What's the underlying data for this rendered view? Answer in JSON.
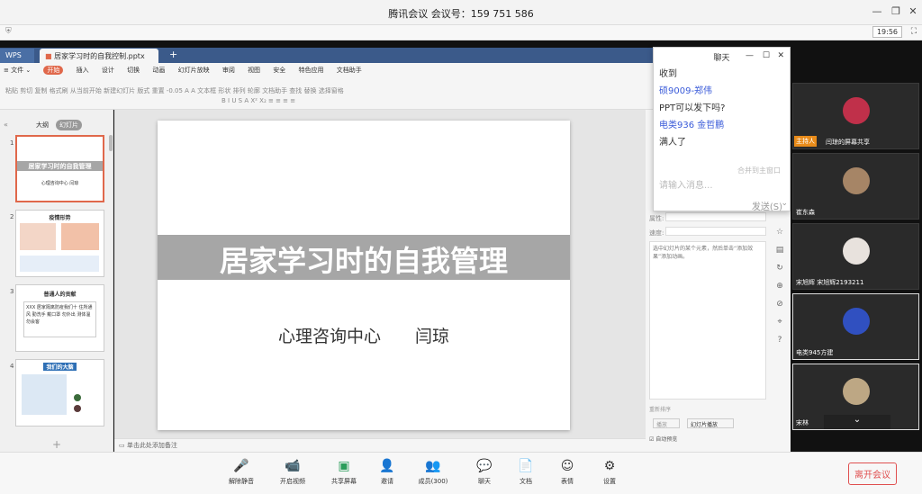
{
  "window": {
    "title": "腾讯会议 会议号：159 751 586",
    "clock": "19:56"
  },
  "wps": {
    "app_tab": "WPS",
    "file_tab": "居家学习时的自我控制.pptx",
    "new_tab": "+",
    "menu": [
      "≡ 文件 ⌄",
      "开始",
      "插入",
      "设计",
      "切换",
      "动画",
      "幻灯片放映",
      "审阅",
      "视图",
      "安全",
      "特色应用",
      "文档助手"
    ],
    "toolbar_row1": "粘贴  剪切  复制 格式刷   从当前开始   新建幻灯片 版式   重置   -0.05   A  A   文本框 形状 排列 轮廓  文档助手   查找   替换   选择窗格",
    "toolbar_row2": "B  I  U  S  A  X²  X₂   ≡  ≡  ≡  ≡",
    "panel_tabs": [
      "大纲",
      "幻灯片"
    ],
    "thumbs": [
      {
        "num": "1",
        "title": "居家学习时的自我管理",
        "sub": "心理咨询中心   闫琼"
      },
      {
        "num": "2",
        "title": "疫情形势",
        "sub": ""
      },
      {
        "num": "3",
        "title": "普通人的贡献",
        "sub": "XXX 居家隔离防疫我们十  住所通风 勤洗手 戴口罩  勿外出 测体温 勿会客"
      },
      {
        "num": "4",
        "title": "我们的大脑",
        "sub": ""
      }
    ],
    "add_slide": "+",
    "notes": "单击此处添加备注",
    "slide": {
      "title": "居家学习时的自我管理",
      "subtitle": "心理咨询中心　　闫琼"
    },
    "right_pane": {
      "label1": "属性:",
      "label2": "速度:",
      "hint": "选中幻灯片的某个元素，然后单击“添加效果”添加动画。",
      "reorder": "重新排序",
      "play": "播放",
      "slideshow": "幻灯片播放",
      "autopreview": "自动预览"
    }
  },
  "chat": {
    "title": "聊天",
    "messages": [
      {
        "text": "收到",
        "color": "normal"
      },
      {
        "text": "硕9009-郑伟",
        "color": "blue"
      },
      {
        "text": "PPT可以发下吗?",
        "color": "normal"
      },
      {
        "text": "电类936 金哲鹏",
        "color": "blue"
      },
      {
        "text": "满人了",
        "color": "normal"
      }
    ],
    "merge": "合并到主窗口",
    "placeholder": "请输入消息...",
    "send": "发送(S)"
  },
  "videos": [
    {
      "name": "闫琼的屏幕共享",
      "host": "主持人",
      "avatar_color": "#c0304a"
    },
    {
      "name": "崔东森",
      "host": "",
      "avatar_color": "#a68566"
    },
    {
      "name": "宋旭辉 宋旭辉2193211",
      "host": "",
      "avatar_color": "#e8e2dd"
    },
    {
      "name": "电类945方建",
      "host": "",
      "avatar_color": "#3050c0"
    },
    {
      "name": "宋林",
      "host": "",
      "avatar_color": "#bda784"
    }
  ],
  "toolbar": {
    "items": [
      {
        "label": "解除静音",
        "icon": "🎤"
      },
      {
        "label": "开启视频",
        "icon": "📹"
      },
      {
        "label": "共享屏幕",
        "icon": "▣"
      },
      {
        "label": "邀请",
        "icon": "👤"
      },
      {
        "label": "成员(300)",
        "icon": "👥"
      },
      {
        "label": "聊天",
        "icon": "💬"
      },
      {
        "label": "文档",
        "icon": "📄"
      },
      {
        "label": "表情",
        "icon": "☺"
      },
      {
        "label": "设置",
        "icon": "⚙"
      }
    ],
    "leave": "离开会议"
  }
}
